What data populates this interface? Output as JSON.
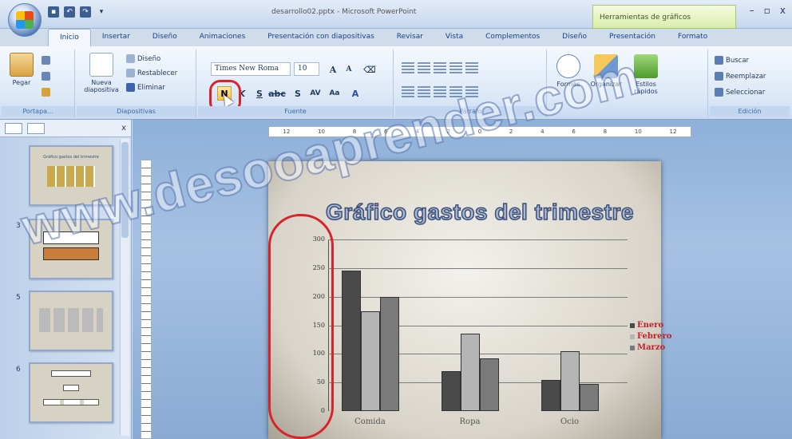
{
  "app": {
    "doc_title": "desarrollo02.pptx - Microsoft PowerPoint",
    "context_tab_group": "Herramientas de gráficos",
    "window_controls": [
      "–",
      "▫",
      "x"
    ]
  },
  "tabs": [
    {
      "label": "Inicio",
      "active": true
    },
    {
      "label": "Insertar"
    },
    {
      "label": "Diseño"
    },
    {
      "label": "Animaciones"
    },
    {
      "label": "Presentación con diapositivas"
    },
    {
      "label": "Revisar"
    },
    {
      "label": "Vista"
    },
    {
      "label": "Complementos"
    },
    {
      "label": "Diseño"
    },
    {
      "label": "Presentación"
    },
    {
      "label": "Formato"
    }
  ],
  "ribbon": {
    "portapapeles": {
      "label": "Portapa...",
      "pegar": "Pegar"
    },
    "diapositivas": {
      "label": "Diapositivas",
      "nueva": "Nueva diapositiva",
      "diseno": "Diseño",
      "restablecer": "Restablecer",
      "eliminar": "Eliminar"
    },
    "fuente": {
      "label": "Fuente",
      "font_name": "Times New Roma",
      "font_size": "10",
      "bold": "N",
      "grow": "A",
      "shrink": "A"
    },
    "parrafo": {
      "label": "Párrafo"
    },
    "dibujo": {
      "formas": "Formas",
      "organizar": "Organizar",
      "estilos": "Estilos rápidos"
    },
    "edicion": {
      "label": "Edición",
      "buscar": "Buscar",
      "reemplazar": "Reemplazar",
      "seleccionar": "Seleccionar"
    }
  },
  "slide_panel": {
    "slides": [
      {
        "num": "",
        "title": "Gráfico gastos del trimestre"
      },
      {
        "num": "3",
        "title": ""
      },
      {
        "num": "5",
        "title": ""
      },
      {
        "num": "6",
        "title": ""
      }
    ]
  },
  "ruler": {
    "labels": [
      "12",
      "10",
      "8",
      "6",
      "4",
      "2",
      "0",
      "2",
      "4",
      "6",
      "8",
      "10",
      "12"
    ]
  },
  "slide": {
    "title": "Gráfico gastos del trimestre"
  },
  "chart_data": {
    "type": "bar",
    "title": "Gráfico gastos del trimestre",
    "categories": [
      "Comida",
      "Ropa",
      "Ocio"
    ],
    "series": [
      {
        "name": "Enero",
        "color": "#4a4a4a",
        "values": [
          245,
          70,
          55
        ]
      },
      {
        "name": "Febrero",
        "color": "#b5b5b5",
        "values": [
          175,
          135,
          105
        ]
      },
      {
        "name": "Marzo",
        "color": "#7a7a7a",
        "values": [
          200,
          92,
          48
        ]
      }
    ],
    "ylim": [
      0,
      300
    ],
    "yticks": [
      "300",
      "250",
      "200",
      "150",
      "100",
      "50",
      "0"
    ],
    "grid": true,
    "legend": "right"
  },
  "watermark": "www.desooaprender.com"
}
